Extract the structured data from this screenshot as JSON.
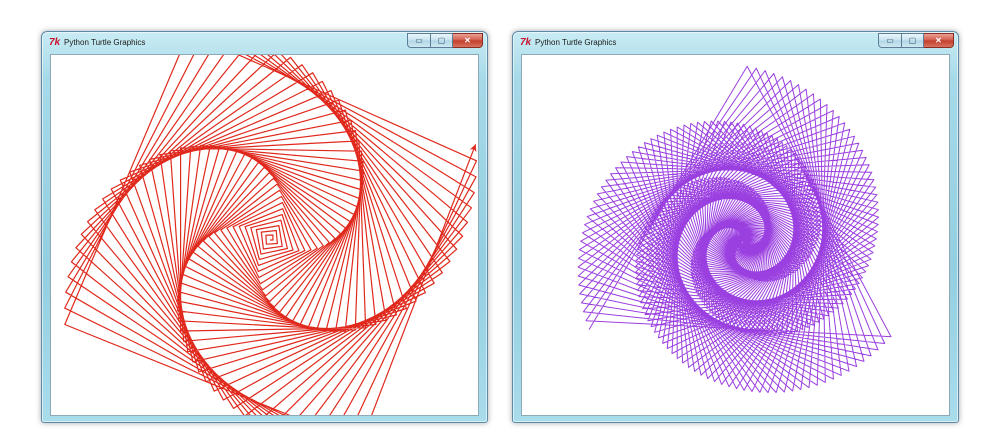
{
  "windows": [
    {
      "title": "Python Turtle Graphics",
      "app_icon": "tk-icon",
      "pen_color": "#e0291c"
    },
    {
      "title": "Python Turtle Graphics",
      "app_icon": "tk-icon",
      "pen_color": "#9a3fe0"
    }
  ],
  "title_controls": {
    "minimize_glyph": "▭",
    "maximize_glyph": "▢",
    "close_glyph": "✕"
  },
  "colors": {
    "frame": "#a6d9e8",
    "tk_icon": "#c8102e",
    "close_button": "#c23c2b"
  }
}
